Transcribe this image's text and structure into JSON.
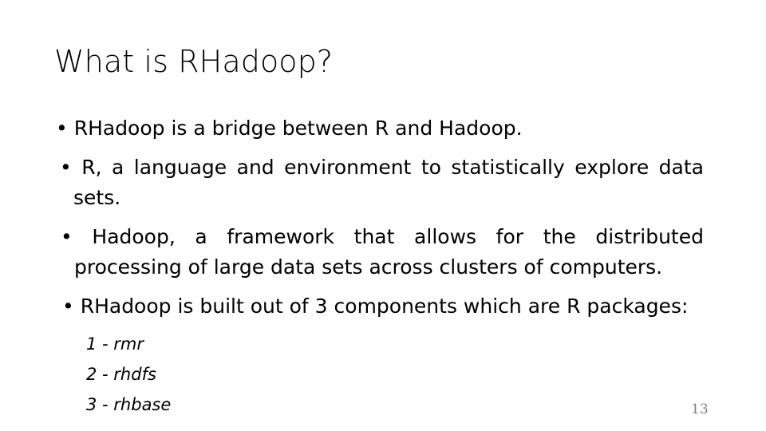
{
  "slide": {
    "title": "What is RHadoop?",
    "page_number": "13",
    "bullet_glyph": "•",
    "text_color": "#000000",
    "page_number_color": "#808080",
    "background_color": "#ffffff",
    "bullets": [
      {
        "text": "RHadoop is a bridge between R and Hadoop."
      },
      {
        "text": "R, a language and environment to statistically explore data sets."
      },
      {
        "text": "Hadoop, a framework that allows for the distributed processing of large data sets across clusters of computers."
      },
      {
        "text": "RHadoop is built out of 3 components which are R packages:"
      }
    ],
    "sub_items": [
      {
        "text": "1 - rmr"
      },
      {
        "text": "2 - rhdfs"
      },
      {
        "text": "3 - rhbase"
      }
    ]
  }
}
